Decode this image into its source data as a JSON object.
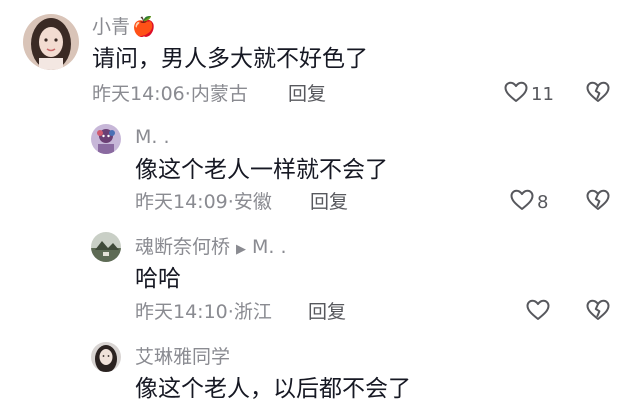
{
  "comments": [
    {
      "username": "小青",
      "username_emoji": "🍎",
      "text": "请问，男人多大就不好色了",
      "time": "昨天14:06",
      "location": "内蒙古",
      "reply_label": "回复",
      "like_count": "11"
    },
    {
      "username": "M. .",
      "text": "像这个老人一样就不会了",
      "time": "昨天14:09",
      "location": "安徽",
      "reply_label": "回复",
      "like_count": "8"
    },
    {
      "username": "魂断奈何桥",
      "reply_to": "M. .",
      "text": "哈哈",
      "time": "昨天14:10",
      "location": "浙江",
      "reply_label": "回复",
      "like_count": ""
    },
    {
      "username": "艾琳雅同学",
      "text": "像这个老人，以后都不会了"
    }
  ],
  "meta_separator": "·",
  "colors": {
    "text_primary": "#161823",
    "text_secondary": "#8a8b91",
    "icon": "#57585d",
    "background": "#ffffff"
  },
  "icons": {
    "like": "heart-outline-icon",
    "dislike": "broken-heart-icon",
    "reply_arrow": "play-arrow-icon"
  }
}
